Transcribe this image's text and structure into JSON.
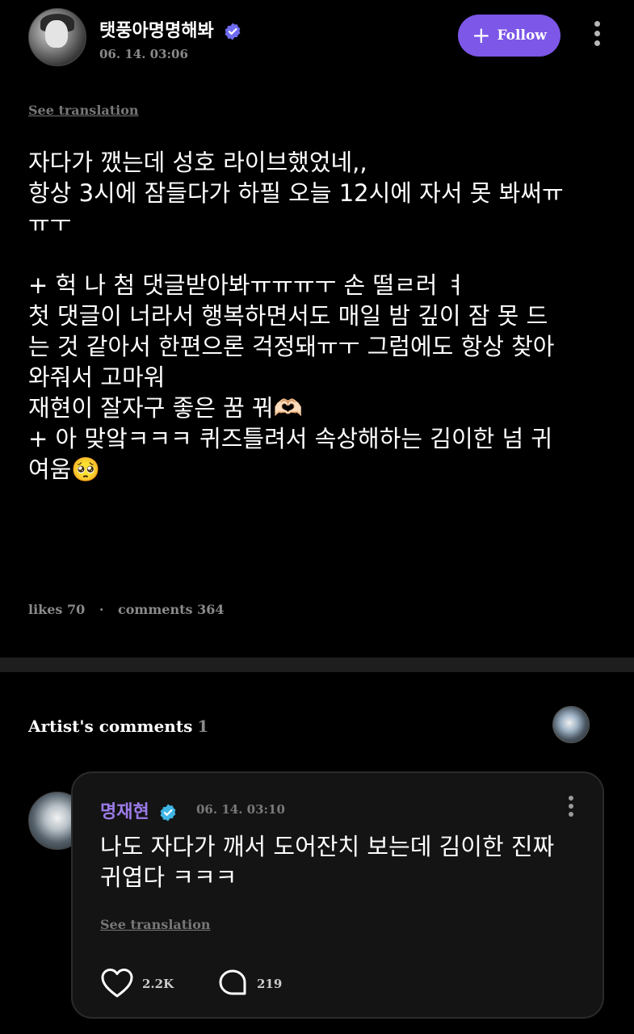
{
  "post": {
    "author": "탯풍아명명해봐",
    "time": "06. 14. 03:06",
    "follow_label": "Follow",
    "see_translation": "See translation",
    "body": "자다가 깼는데 성호 라이브했었네,,\n항상 3시에 잠들다가 하필 오늘 12시에 자서 못 봐써ㅠ\nㅠㅜ\n\n+ 헉 나 첨 댓글받아봐ㅠㅠㅠㅜ 손 떨ㄹ러 ㅕ\n첫 댓글이 너라서 행복하면서도 매일 밤 깊이 잠 못 드\n는 것 같아서 한편으론 걱정돼ㅠㅜ 그럼에도 항상 찾아\n와줘서 고마워\n재현이 잘자구 좋은 꿈 꿔🫶🏻\n+ 아 맞앜ㅋㅋㅋ 퀴즈틀려서 속상해하는 김이한 넘 귀\n여움🥺",
    "likes_label": "likes",
    "likes_count": "70",
    "comments_label": "comments",
    "comments_count": "364",
    "separator": "·"
  },
  "artist_comments": {
    "title": "Artist's comments",
    "count": "1"
  },
  "comment": {
    "author": "명재현",
    "time": "06. 14. 03:10",
    "text": "나도 자다가 깨서 도어잔치 보는데 김이한 진짜\n귀엽다 ㅋㅋㅋ",
    "see_translation": "See translation",
    "likes": "2.2K",
    "replies": "219"
  },
  "colors": {
    "background": "#000000",
    "accent": "#7c57e8",
    "artist_name": "#9b7be8",
    "verified_badge_user": "#6f6cf0",
    "verified_badge_artist": "#3fb6e6"
  },
  "icons": [
    "verified-badge-icon",
    "plus-icon",
    "more-vertical-icon",
    "heart-icon",
    "comment-bubble-icon"
  ]
}
